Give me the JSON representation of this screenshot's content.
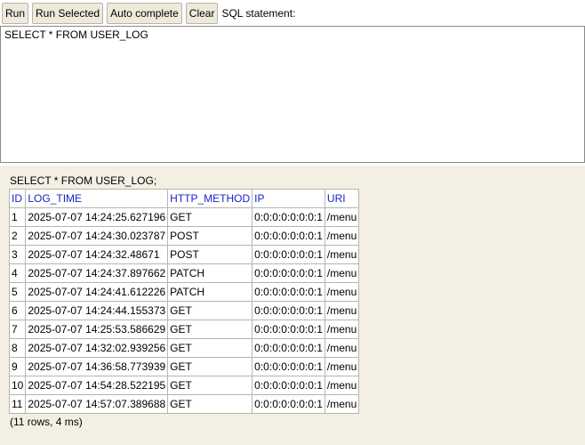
{
  "toolbar": {
    "buttons": [
      "Run",
      "Run Selected",
      "Auto complete",
      "Clear"
    ],
    "label": "SQL statement:"
  },
  "editor": {
    "value": "SELECT * FROM USER_LOG"
  },
  "results": {
    "query": "SELECT * FROM USER_LOG;",
    "columns": [
      "ID",
      "LOG_TIME",
      "HTTP_METHOD",
      "IP",
      "URI"
    ],
    "rows": [
      [
        "1",
        "2025-07-07 14:24:25.627196",
        "GET",
        "0:0:0:0:0:0:0:1",
        "/menu"
      ],
      [
        "2",
        "2025-07-07 14:24:30.023787",
        "POST",
        "0:0:0:0:0:0:0:1",
        "/menu"
      ],
      [
        "3",
        "2025-07-07 14:24:32.48671",
        "POST",
        "0:0:0:0:0:0:0:1",
        "/menu"
      ],
      [
        "4",
        "2025-07-07 14:24:37.897662",
        "PATCH",
        "0:0:0:0:0:0:0:1",
        "/menu"
      ],
      [
        "5",
        "2025-07-07 14:24:41.612226",
        "PATCH",
        "0:0:0:0:0:0:0:1",
        "/menu"
      ],
      [
        "6",
        "2025-07-07 14:24:44.155373",
        "GET",
        "0:0:0:0:0:0:0:1",
        "/menu"
      ],
      [
        "7",
        "2025-07-07 14:25:53.586629",
        "GET",
        "0:0:0:0:0:0:0:1",
        "/menu"
      ],
      [
        "8",
        "2025-07-07 14:32:02.939256",
        "GET",
        "0:0:0:0:0:0:0:1",
        "/menu"
      ],
      [
        "9",
        "2025-07-07 14:36:58.773939",
        "GET",
        "0:0:0:0:0:0:0:1",
        "/menu"
      ],
      [
        "10",
        "2025-07-07 14:54:28.522195",
        "GET",
        "0:0:0:0:0:0:0:1",
        "/menu"
      ],
      [
        "11",
        "2025-07-07 14:57:07.389688",
        "GET",
        "0:0:0:0:0:0:0:1",
        "/menu"
      ]
    ],
    "summary": "(11 rows, 4 ms)"
  },
  "colors": {
    "results_background": "#f3f0e3",
    "header_text": "#1a22c8",
    "button_background": "#eeeadb"
  }
}
